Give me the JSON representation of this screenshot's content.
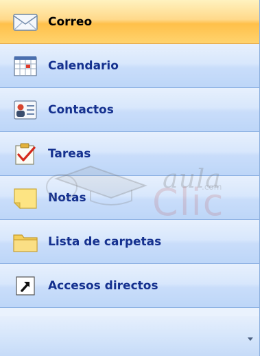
{
  "nav": {
    "items": [
      {
        "label": "Correo",
        "icon": "mail-icon",
        "selected": true
      },
      {
        "label": "Calendario",
        "icon": "calendar-icon",
        "selected": false
      },
      {
        "label": "Contactos",
        "icon": "contacts-icon",
        "selected": false
      },
      {
        "label": "Tareas",
        "icon": "tasks-icon",
        "selected": false
      },
      {
        "label": "Notas",
        "icon": "notes-icon",
        "selected": false
      },
      {
        "label": "Lista de carpetas",
        "icon": "folder-icon",
        "selected": false
      },
      {
        "label": "Accesos directos",
        "icon": "shortcut-icon",
        "selected": false
      }
    ]
  },
  "watermark": {
    "line1": "aula",
    "line2": "Clic",
    "line3": ".com"
  },
  "colors": {
    "selected_gradient": "#ffc04a",
    "normal_gradient": "#c9ddfa",
    "label": "#15318f",
    "border": "#8cb1e3"
  }
}
